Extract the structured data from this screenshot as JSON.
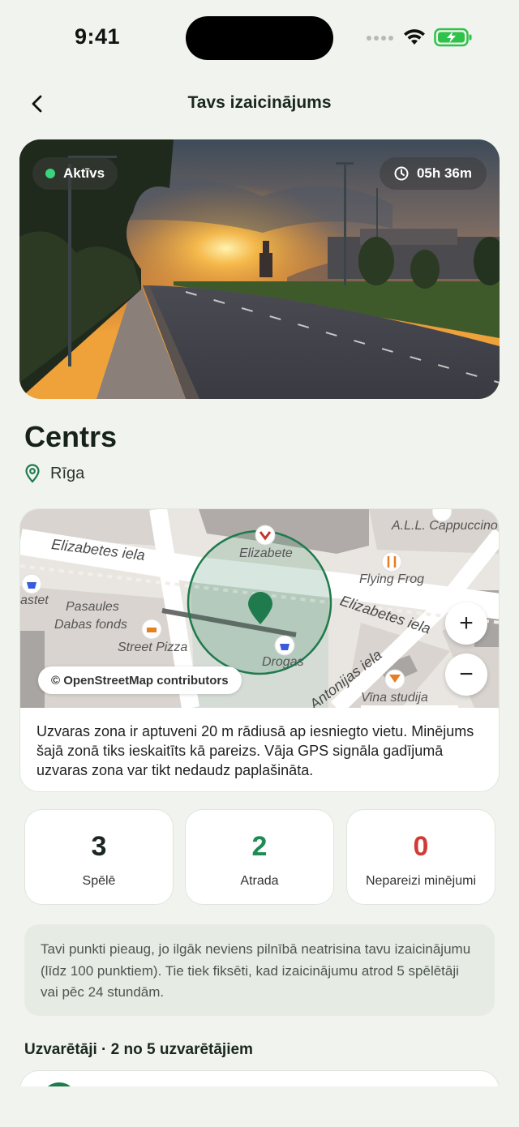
{
  "status_bar": {
    "time": "9:41"
  },
  "header": {
    "title": "Tavs izaicinājums"
  },
  "hero": {
    "status": "Aktīvs",
    "timer": "05h 36m"
  },
  "location": {
    "name": "Centrs",
    "city": "Rīga"
  },
  "map": {
    "labels": {
      "street_1": "Elizabetes iela",
      "street_2": "Elizabetes iela",
      "street_3": "Antonijas iela",
      "poi_1": "Elizabete",
      "poi_2": "Flying Frog",
      "poi_3": "A.L.L. Cappuccino",
      "poi_4": "Pasaules",
      "poi_5": "Dabas fonds",
      "poi_6": "Street Pizza",
      "poi_7": "Drogas",
      "poi_8": "Vīna studija",
      "poi_9": "astet"
    },
    "attribution": "© OpenStreetMap contributors",
    "zoom_in": "+",
    "zoom_out": "−",
    "description": "Uzvaras zona ir aptuveni 20 m rādiusā ap iesniegto vietu. Minējums šajā zonā tiks ieskaitīts kā pareizs. Vāja GPS signāla gadījumā uzvaras zona var tikt nedaudz paplašināta."
  },
  "stats": [
    {
      "value": "3",
      "label": "Spēlē",
      "color": "#1b2620"
    },
    {
      "value": "2",
      "label": "Atrada",
      "color": "#1f8a52"
    },
    {
      "value": "0",
      "label": "Nepareizi minējumi",
      "color": "#d23b35"
    }
  ],
  "info": "Tavi punkti pieaug, jo ilgāk neviens pilnībā neatrisina tavu izaicinājumu (līdz 100 punktiem). Tie tiek fiksēti, kad izaicinājumu atrod 5 spēlētāji vai pēc 24 stundām.",
  "winners": {
    "title": "Uzvarētāji · 2 no 5 uzvarētājiem"
  },
  "colors": {
    "accent": "#1f7a4d",
    "background": "#f1f4ee",
    "danger": "#d23b35"
  }
}
